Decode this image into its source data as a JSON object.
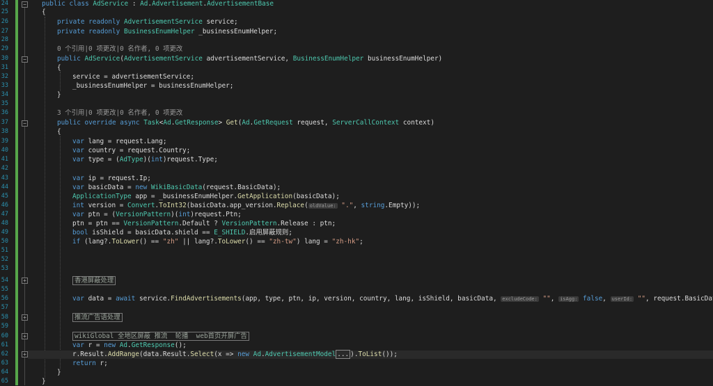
{
  "gutter": {
    "line_numbers": [
      "24",
      "25",
      "26",
      "27",
      "28",
      "29",
      "30",
      "31",
      "32",
      "33",
      "34",
      "35",
      "36",
      "37",
      "38",
      "39",
      "40",
      "41",
      "42",
      "43",
      "44",
      "45",
      "46",
      "47",
      "48",
      "49",
      "50",
      "51",
      "52",
      "53",
      "54",
      "55",
      "56",
      "57",
      "58",
      "59",
      "60",
      "61",
      "62",
      "63",
      "64",
      "65"
    ]
  },
  "code": {
    "class_decl": {
      "a": "public class ",
      "b": "AdService",
      "c": " : ",
      "d": "Ad",
      "e": ".",
      "f": "Advertisement",
      "g": ".",
      "h": "AdvertisementBase"
    },
    "open_brace_class": "{",
    "field1": {
      "a": "private readonly ",
      "b": "AdvertisementService",
      "c": " service;"
    },
    "field2": {
      "a": "private readonly ",
      "b": "BusinessEnumHelper",
      "c": " _businessEnumHelper;"
    },
    "codelens1": "0 个引用|0 项更改|0 名作者, 0 项更改",
    "ctor_decl": {
      "a": "public ",
      "b": "AdService",
      "c": "(",
      "d": "AdvertisementService",
      "e": " advertisementService, ",
      "f": "BusinessEnumHelper",
      "g": " businessEnumHelper)"
    },
    "open_brace_ctor": "{",
    "ctor_line1": "service = advertisementService;",
    "ctor_line2": "_businessEnumHelper = businessEnumHelper;",
    "close_brace_ctor": "}",
    "codelens2": "3 个引用|0 项更改|0 名作者, 0 项更改",
    "get_decl": {
      "a": "public override async ",
      "b": "Task",
      "c": "<",
      "d": "Ad",
      "e": ".",
      "f": "GetResponse",
      "g": "> ",
      "h": "Get",
      "i": "(",
      "j": "Ad",
      "k": ".",
      "l": "GetRequest",
      "m": " request, ",
      "n": "ServerCallContext",
      "o": " context)"
    },
    "open_brace_get": "{",
    "l_lang": {
      "a": "var",
      "b": " lang = request.Lang;"
    },
    "l_country": {
      "a": "var",
      "b": " country = request.Country;"
    },
    "l_type": {
      "a": "var",
      "b": " type = (",
      "c": "AdType",
      "d": ")(",
      "e": "int",
      "f": ")request.Type;"
    },
    "l_ip": {
      "a": "var",
      "b": " ip = request.Ip;"
    },
    "l_basic": {
      "a": "var",
      "b": " basicData = ",
      "c": "new ",
      "d": "WikiBasicData",
      "e": "(request.BasicData);"
    },
    "l_app": {
      "a": "ApplicationType",
      "b": " app = _businessEnumHelper.",
      "c": "GetApplication",
      "d": "(basicData);"
    },
    "l_version": {
      "a": "int",
      "b": " version = ",
      "c": "Convert",
      "d": ".",
      "e": "ToInt32",
      "f": "(basicData.app_version.",
      "g": "Replace",
      "h": "(",
      "pn": "oldValue:",
      "i": " \".\"",
      "j": ", ",
      "k": "string",
      "l": ".Empty));"
    },
    "l_ptn": {
      "a": "var",
      "b": " ptn = (",
      "c": "VersionPattern",
      "d": ")(",
      "e": "int",
      "f": ")request.Ptn;"
    },
    "l_ptn2": {
      "a": "ptn = ptn == ",
      "b": "VersionPattern",
      "c": ".Default ? ",
      "d": "VersionPattern",
      "e": ".Release : ptn;"
    },
    "l_shield": {
      "a": "bool",
      "b": " isShield = basicData.shield == ",
      "c": "E_SHIELD",
      "d": ".启用屏蔽规则;"
    },
    "l_if": {
      "a": "if",
      "b": " (lang?.",
      "c": "ToLower",
      "d": "() == ",
      "e": "\"zh\"",
      "f": " || lang?.",
      "g": "ToLower",
      "h": "() == ",
      "i": "\"zh-tw\"",
      "j": ") lang = ",
      "k": "\"zh-hk\"",
      "l": ";"
    },
    "region1": "香港屏蔽处理",
    "l_data": {
      "a": "var",
      "b": " data = ",
      "c": "await",
      "d": " service.",
      "e": "FindAdvertisements",
      "f": "(app, type, ptn, ip, version, country, lang, isShield, basicData, ",
      "pn1": "excludeCode:",
      "g": " \"\"",
      "h": ", ",
      "pn2": "isAgg:",
      "i": " false",
      "j": ", ",
      "pn3": "userId:",
      "k": " \"\"",
      "l": ", request.BasicData);"
    },
    "region2": "推流广告语处理",
    "region3": "wikiGlobal 全地区屏蔽 推流  轮播  web首页开屏广告",
    "l_r": {
      "a": "var",
      "b": " r = ",
      "c": "new ",
      "d": "Ad",
      "e": ".",
      "f": "GetResponse",
      "g": "();"
    },
    "l_add": {
      "a": "r.Result.",
      "b": "AddRange",
      "c": "(data.Result.",
      "d": "Select",
      "e": "(x => ",
      "f": "new ",
      "g": "Ad",
      "h": ".",
      "i": "AdvertisementModel",
      "j": "...",
      "k": ").",
      "l": "ToList",
      "m": "());"
    },
    "l_return": {
      "a": "return",
      "b": " r;"
    },
    "close_brace_get": "}",
    "close_brace_class": "}"
  },
  "colors": {
    "background": "#1e1e1e",
    "keyword": "#569cd6",
    "type": "#4ec9b0",
    "method": "#dcdcaa",
    "string": "#d69d85",
    "line_number": "#2b91af",
    "change_bar": "#57a64a"
  }
}
